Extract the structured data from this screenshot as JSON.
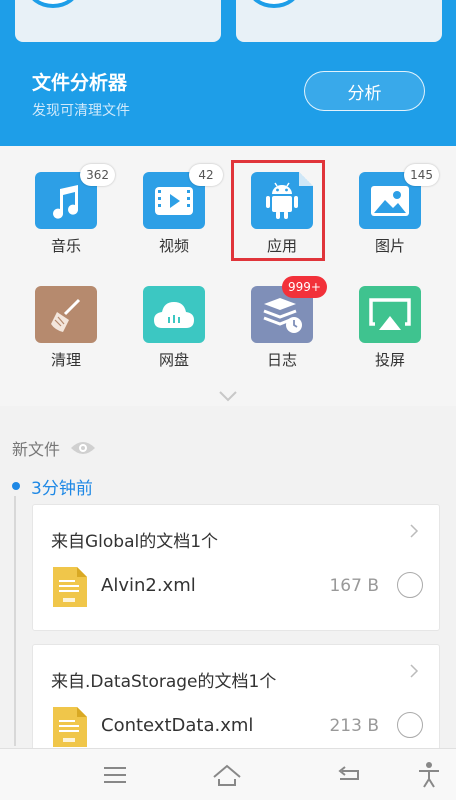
{
  "header": {
    "title": "文件分析器",
    "subtitle": "发现可清理文件",
    "analyze_label": "分析",
    "bg_color": "#1e9ee8"
  },
  "categories": [
    {
      "label": "音乐",
      "badge": "362",
      "icon": "music-note-icon",
      "color": "#2d9fe6"
    },
    {
      "label": "视频",
      "badge": "42",
      "icon": "video-play-icon",
      "color": "#2d9fe6"
    },
    {
      "label": "应用",
      "badge": "",
      "icon": "android-icon",
      "color": "#2d9fe6"
    },
    {
      "label": "图片",
      "badge": "145",
      "icon": "picture-icon",
      "color": "#2d9fe6"
    },
    {
      "label": "清理",
      "badge": "",
      "icon": "broom-icon",
      "color": "#b68a6e"
    },
    {
      "label": "网盘",
      "badge": "",
      "icon": "cloud-icon",
      "color": "#3cc7c2"
    },
    {
      "label": "日志",
      "badge": "999+",
      "icon": "log-stack-icon",
      "color": "#7f8fb8"
    },
    {
      "label": "投屏",
      "badge": "",
      "icon": "cast-screen-icon",
      "color": "#3fc38f"
    }
  ],
  "new_files": {
    "section_title": "新文件",
    "time_label": "3分钟前",
    "groups": [
      {
        "title": "来自Global的文档1个",
        "file_name": "Alvin2.xml",
        "size": "167 B"
      },
      {
        "title": "来自.DataStorage的文档1个",
        "file_name": "ContextData.xml",
        "size": "213 B"
      }
    ]
  },
  "bottom_nav": [
    "menu-icon",
    "home-icon",
    "back-icon",
    "accessibility-icon"
  ]
}
